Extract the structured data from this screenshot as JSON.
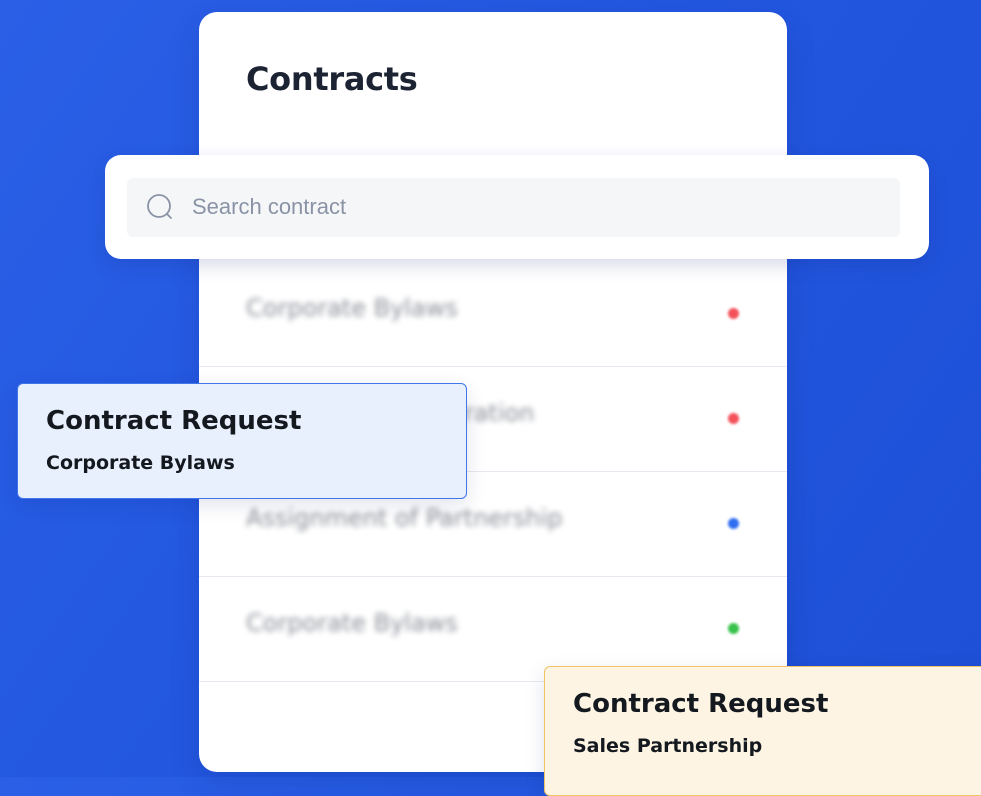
{
  "panel": {
    "title": "Contracts"
  },
  "search": {
    "placeholder": "Search contract",
    "icon": "search-icon"
  },
  "contracts": [
    {
      "label": "Corporate Bylaws",
      "status_color": "#f4515a"
    },
    {
      "label": "Articles of Incorporation",
      "status_color": "#f4515a"
    },
    {
      "label": "Assignment of Partnership",
      "status_color": "#2f6df0"
    },
    {
      "label": "Corporate Bylaws",
      "status_color": "#36c24a"
    }
  ],
  "notifications": [
    {
      "title": "Contract Request",
      "subtitle": "Corporate Bylaws",
      "accent": "#3f76ea"
    },
    {
      "title": "Contract Request",
      "subtitle": "Sales Partnership",
      "accent": "#f0c465"
    }
  ]
}
